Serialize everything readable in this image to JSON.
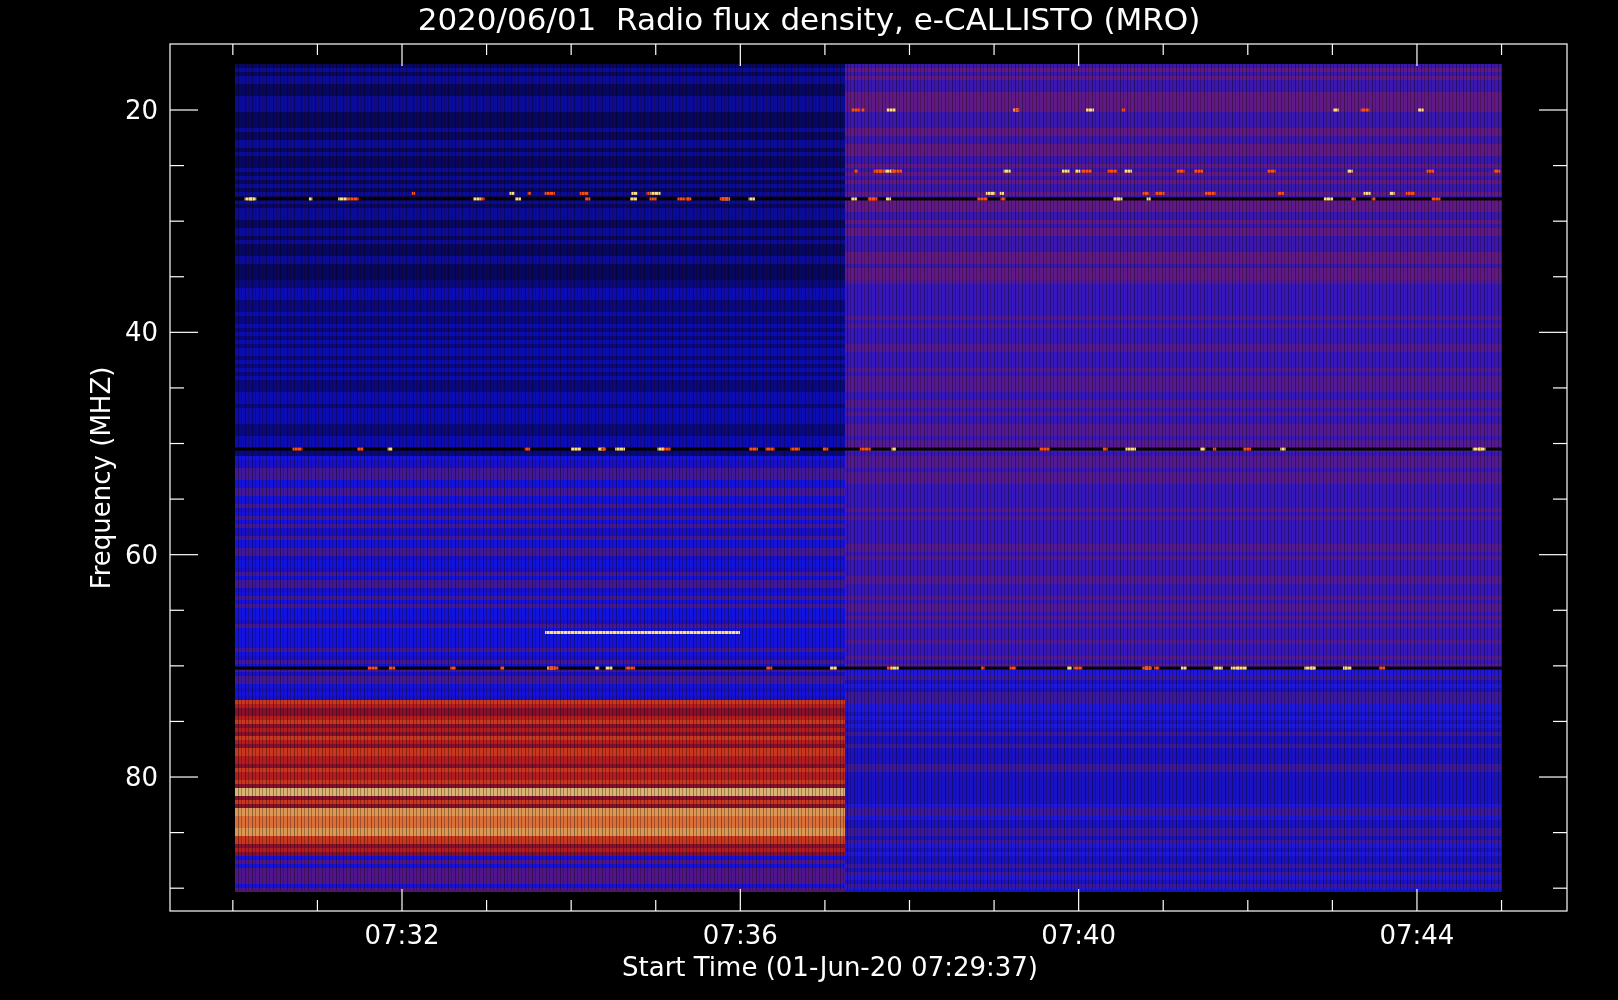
{
  "chart": {
    "title": "2020/06/01  Radio flux density, e-CALLISTO (MRO)",
    "ylabel": "Frequency (MHZ)",
    "xlabel": "Start Time (01-Jun-20 07:29:37)",
    "yticks": [
      "20",
      "40",
      "60",
      "80"
    ],
    "xticks": [
      "07:32",
      "07:36",
      "07:40",
      "07:44"
    ]
  }
}
